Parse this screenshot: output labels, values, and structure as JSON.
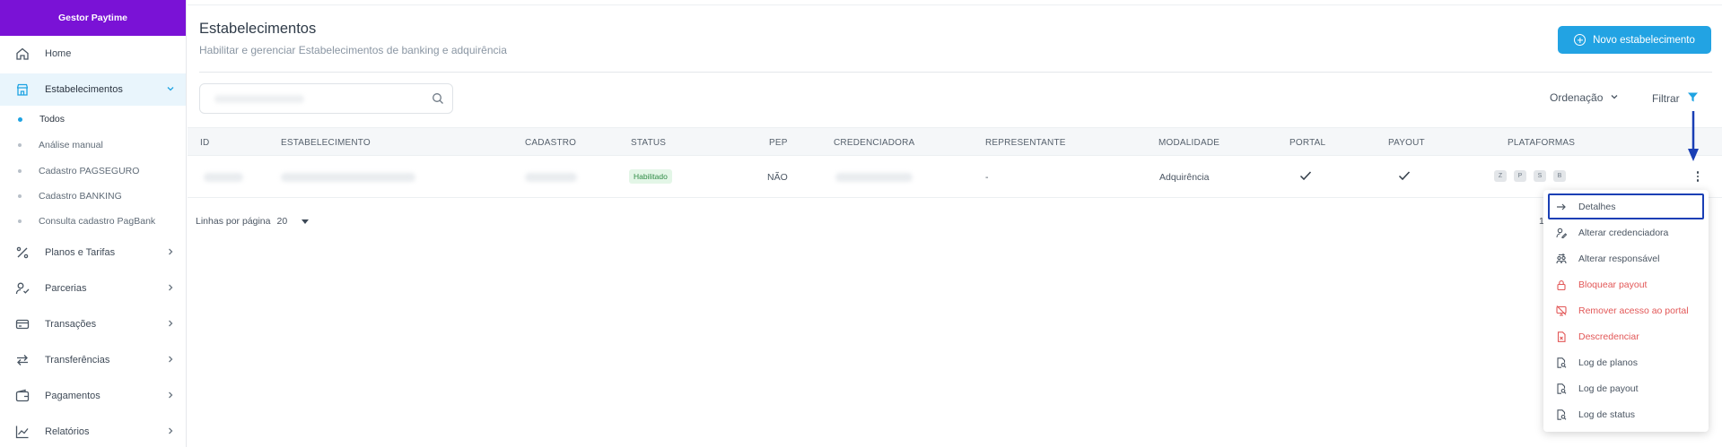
{
  "brand": "Gestor Paytime",
  "sidebar": {
    "items": [
      {
        "label": "Home",
        "icon": "home-icon"
      },
      {
        "label": "Estabelecimentos",
        "icon": "store-icon"
      },
      {
        "label": "Planos e Tarifas",
        "icon": "percent-icon"
      },
      {
        "label": "Parcerias",
        "icon": "user-check-icon"
      },
      {
        "label": "Transações",
        "icon": "credit-card-icon"
      },
      {
        "label": "Transferências",
        "icon": "transfer-icon"
      },
      {
        "label": "Pagamentos",
        "icon": "wallet-icon"
      },
      {
        "label": "Relatórios",
        "icon": "chart-line-icon"
      }
    ],
    "subitems": [
      {
        "label": "Todos",
        "active": true
      },
      {
        "label": "Análise manual"
      },
      {
        "label": "Cadastro PAGSEGURO"
      },
      {
        "label": "Cadastro BANKING"
      },
      {
        "label": "Consulta cadastro PagBank"
      }
    ]
  },
  "header": {
    "title": "Estabelecimentos",
    "subtitle": "Habilitar e gerenciar Estabelecimentos de banking e adquirência",
    "new_button": "Novo estabelecimento"
  },
  "toolbar": {
    "search_placeholder": "",
    "sort_label": "Ordenação",
    "filter_label": "Filtrar"
  },
  "table": {
    "columns": [
      "ID",
      "ESTABELECIMENTO",
      "CADASTRO",
      "STATUS",
      "PEP",
      "CREDENCIADORA",
      "REPRESENTANTE",
      "MODALIDADE",
      "PORTAL",
      "PAYOUT",
      "PLATAFORMAS"
    ],
    "rows": [
      {
        "status": "Habilitado",
        "pep": "NÃO",
        "representante": "-",
        "modalidade": "Adquirência",
        "portal": true,
        "payout": true,
        "plataformas": [
          "Z",
          "P",
          "S",
          "B"
        ]
      }
    ]
  },
  "pagination": {
    "rows_per_page_label": "Linhas por página",
    "rows_per_page_value": "20",
    "tail": "1"
  },
  "menu": {
    "items": [
      {
        "label": "Detalhes",
        "icon": "arrow-right-icon",
        "danger": false
      },
      {
        "label": "Alterar credenciadora",
        "icon": "user-edit-icon",
        "danger": false
      },
      {
        "label": "Alterar responsável",
        "icon": "users-swap-icon",
        "danger": false
      },
      {
        "label": "Bloquear payout",
        "icon": "lock-icon",
        "danger": true
      },
      {
        "label": "Remover acesso ao portal",
        "icon": "monitor-off-icon",
        "danger": true
      },
      {
        "label": "Descredenciar",
        "icon": "file-x-icon",
        "danger": true
      },
      {
        "label": "Log de planos",
        "icon": "file-search-icon",
        "danger": false
      },
      {
        "label": "Log de payout",
        "icon": "file-search-icon",
        "danger": false
      },
      {
        "label": "Log de status",
        "icon": "file-search-icon",
        "danger": false
      }
    ]
  },
  "colors": {
    "brand": "#7a12d6",
    "accent": "#22a3e3",
    "danger": "#e25757",
    "success": "#2e8b45",
    "annotation": "#1a3fb5"
  }
}
